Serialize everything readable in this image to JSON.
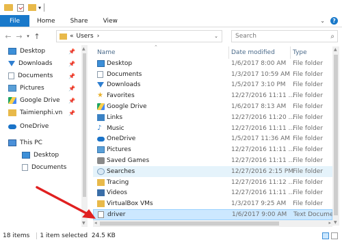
{
  "ribbon": {
    "file": "File",
    "home": "Home",
    "share": "Share",
    "view": "View"
  },
  "address": {
    "prefix": "«",
    "path": "Users",
    "arrow": "›"
  },
  "search": {
    "placeholder": "Search"
  },
  "nav": {
    "items": [
      {
        "label": "Desktop",
        "icon": "desktop-icon",
        "pinned": true
      },
      {
        "label": "Downloads",
        "icon": "downloads-icon",
        "pinned": true
      },
      {
        "label": "Documents",
        "icon": "documents-icon",
        "pinned": true
      },
      {
        "label": "Pictures",
        "icon": "pictures-icon",
        "pinned": true
      },
      {
        "label": "Google Drive",
        "icon": "google-drive-icon",
        "pinned": true
      },
      {
        "label": "Taimienphi.vn",
        "icon": "folder-icon",
        "pinned": true
      },
      {
        "label": "OneDrive",
        "icon": "onedrive-icon",
        "pinned": false
      },
      {
        "label": "This PC",
        "icon": "this-pc-icon",
        "pinned": false
      },
      {
        "label": "Desktop",
        "icon": "desktop-icon",
        "pinned": false
      },
      {
        "label": "Documents",
        "icon": "documents-icon",
        "pinned": false
      }
    ]
  },
  "columns": {
    "name": "Name",
    "date": "Date modified",
    "type": "Type"
  },
  "files": [
    {
      "name": "Desktop",
      "date": "1/6/2017 8:00 AM",
      "type": "File folder",
      "icon": "desktop-icon"
    },
    {
      "name": "Documents",
      "date": "1/3/2017 10:59 AM",
      "type": "File folder",
      "icon": "documents-icon"
    },
    {
      "name": "Downloads",
      "date": "1/5/2017 3:10 PM",
      "type": "File folder",
      "icon": "downloads-icon"
    },
    {
      "name": "Favorites",
      "date": "12/27/2016 11:11 ...",
      "type": "File folder",
      "icon": "star-icon"
    },
    {
      "name": "Google Drive",
      "date": "1/6/2017 8:13 AM",
      "type": "File folder",
      "icon": "google-drive-icon"
    },
    {
      "name": "Links",
      "date": "12/27/2016 11:20 ...",
      "type": "File folder",
      "icon": "links-icon"
    },
    {
      "name": "Music",
      "date": "12/27/2016 11:11 ...",
      "type": "File folder",
      "icon": "music-icon"
    },
    {
      "name": "OneDrive",
      "date": "1/5/2017 11:36 AM",
      "type": "File folder",
      "icon": "onedrive-icon"
    },
    {
      "name": "Pictures",
      "date": "12/27/2016 11:11 ...",
      "type": "File folder",
      "icon": "pictures-icon"
    },
    {
      "name": "Saved Games",
      "date": "12/27/2016 11:11 ...",
      "type": "File folder",
      "icon": "saved-games-icon"
    },
    {
      "name": "Searches",
      "date": "12/27/2016 2:15 PM",
      "type": "File folder",
      "icon": "searches-icon"
    },
    {
      "name": "Tracing",
      "date": "12/27/2016 11:12 ...",
      "type": "File folder",
      "icon": "folder-icon"
    },
    {
      "name": "Videos",
      "date": "12/27/2016 11:11 ...",
      "type": "File folder",
      "icon": "videos-icon"
    },
    {
      "name": "VirtualBox VMs",
      "date": "1/3/2017 9:25 AM",
      "type": "File folder",
      "icon": "folder-icon"
    },
    {
      "name": "driver",
      "date": "1/6/2017 9:00 AM",
      "type": "Text Documen",
      "icon": "text-file-icon"
    }
  ],
  "status": {
    "items": "18 items",
    "selected": "1 item selected  24.5 KB"
  },
  "colors": {
    "accent": "#1979ca",
    "folder": "#e8b94a",
    "selection": "#cce8ff",
    "hover": "#e5f3fb",
    "arrow": "#e02020"
  }
}
